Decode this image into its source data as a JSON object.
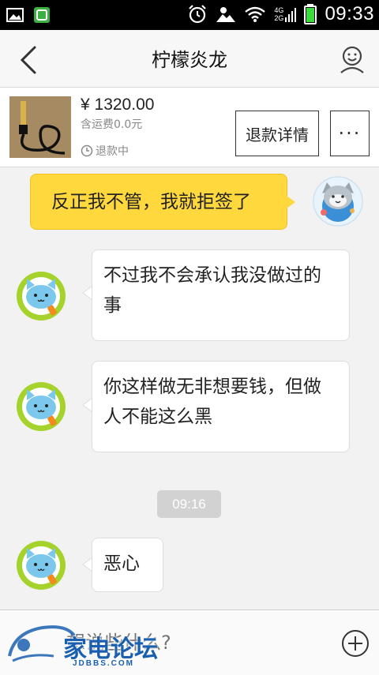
{
  "status_bar": {
    "time": "09:33",
    "network_4g": "4G",
    "network_2g": "2G"
  },
  "header": {
    "title": "柠檬炎龙"
  },
  "order": {
    "price": "¥ 1320.00",
    "shipping": "含运费0.0元",
    "status": "退款中",
    "refund_button": "退款详情",
    "more_button": "···"
  },
  "messages": [
    {
      "sender": "self",
      "text": "反正我不管，我就拒签了"
    },
    {
      "sender": "other",
      "text": "不过我不会承认我没做过的事"
    },
    {
      "sender": "other",
      "text": "你这样做无非想要钱，但做人不能这么黑"
    },
    {
      "sender": "other",
      "text": "恶心"
    }
  ],
  "timestamp": "09:16",
  "input": {
    "placeholder": "想说些什么?"
  },
  "watermark": {
    "title": "家电论坛",
    "url": "JDBBS.COM"
  },
  "colors": {
    "self_bubble": "#ffd83d",
    "other_bubble": "#ffffff",
    "avatar_ring": "#a6d32b",
    "watermark": "#1a5fb0"
  }
}
